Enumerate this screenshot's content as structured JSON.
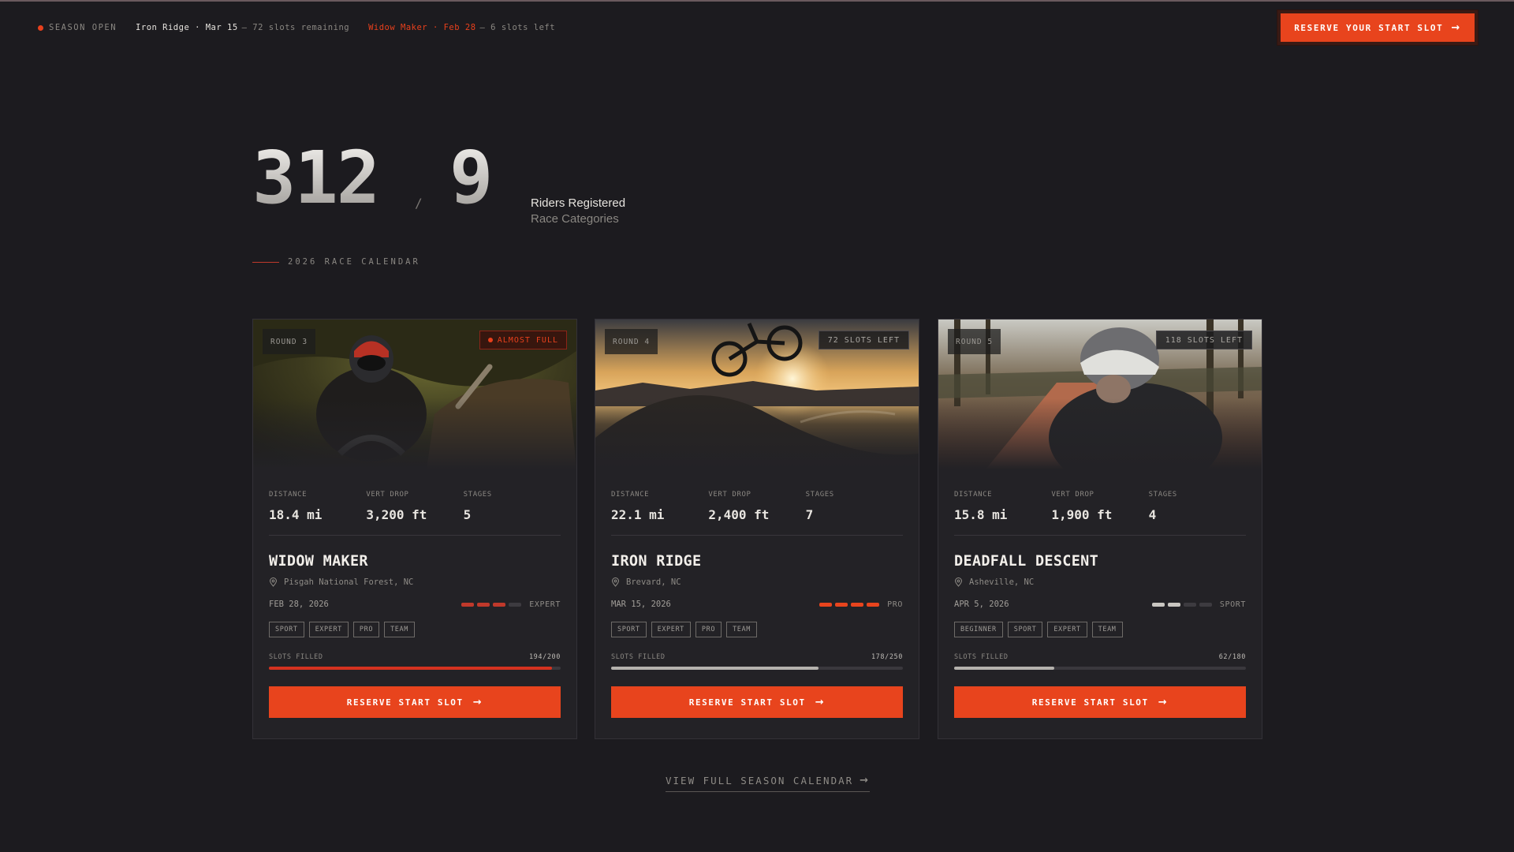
{
  "ticker": {
    "season": "SEASON OPEN",
    "events": [
      {
        "name": "Iron Ridge · Mar 15",
        "note": "— 72 slots remaining",
        "hot": false
      },
      {
        "name": "Widow Maker · Feb 28",
        "note": "— 6 slots left",
        "hot": true
      }
    ]
  },
  "header": {
    "cta_label": "RESERVE YOUR START SLOT"
  },
  "hero": {
    "riders": "312",
    "categories": "9",
    "separator": "/",
    "riders_label": "Riders Registered",
    "categories_label": "Race Categories"
  },
  "calendar": {
    "label": "2026 RACE CALENDAR",
    "view_all": "VIEW FULL SEASON CALENDAR"
  },
  "stat_labels": {
    "distance": "DISTANCE",
    "vert": "VERT DROP",
    "stages": "STAGES",
    "slots_filled": "SLOTS FILLED"
  },
  "colors": {
    "accent": "#e8441d",
    "danger_bar": "#d4321f",
    "neutral_bar": "#b5b2ad"
  },
  "races": [
    {
      "round": "ROUND 3",
      "badge": "ALMOST FULL",
      "badge_type": "full",
      "distance": "18.4 mi",
      "vert": "3,200 ft",
      "stages": "5",
      "name": "WIDOW MAKER",
      "location": "Pisgah National Forest, NC",
      "date": "FEB 28, 2026",
      "difficulty": "EXPERT",
      "difficulty_level": 3,
      "difficulty_color": "#c0392b",
      "tags": [
        "SPORT",
        "EXPERT",
        "PRO",
        "TEAM"
      ],
      "filled": 194,
      "capacity": 200,
      "slots_text": "194/200",
      "bar_color": "#d4321f",
      "button": "RESERVE START SLOT",
      "scene": "forest"
    },
    {
      "round": "ROUND 4",
      "badge": "72 SLOTS LEFT",
      "badge_type": "slots",
      "distance": "22.1 mi",
      "vert": "2,400 ft",
      "stages": "7",
      "name": "IRON RIDGE",
      "location": "Brevard, NC",
      "date": "MAR 15, 2026",
      "difficulty": "PRO",
      "difficulty_level": 4,
      "difficulty_color": "#e8441d",
      "tags": [
        "SPORT",
        "EXPERT",
        "PRO",
        "TEAM"
      ],
      "filled": 178,
      "capacity": 250,
      "slots_text": "178/250",
      "bar_color": "#b5b2ad",
      "button": "RESERVE START SLOT",
      "scene": "sunset"
    },
    {
      "round": "ROUND 5",
      "badge": "118 SLOTS LEFT",
      "badge_type": "slots",
      "distance": "15.8 mi",
      "vert": "1,900 ft",
      "stages": "4",
      "name": "DEADFALL DESCENT",
      "location": "Asheville, NC",
      "date": "APR 5, 2026",
      "difficulty": "SPORT",
      "difficulty_level": 2,
      "difficulty_color": "#c9c6c1",
      "tags": [
        "BEGINNER",
        "SPORT",
        "EXPERT",
        "TEAM"
      ],
      "filled": 62,
      "capacity": 180,
      "slots_text": "62/180",
      "bar_color": "#b5b2ad",
      "button": "RESERVE START SLOT",
      "scene": "dirtroad"
    }
  ]
}
